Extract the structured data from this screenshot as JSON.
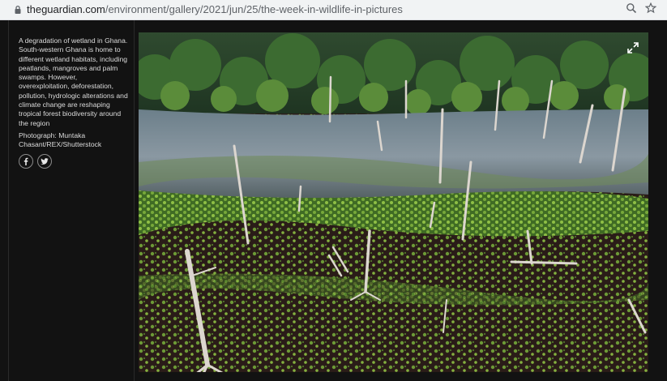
{
  "browser": {
    "url_host": "theguardian.com",
    "url_path": "/environment/gallery/2021/jun/25/the-week-in-wildlife-in-pictures"
  },
  "gallery": {
    "caption": "A degradation of wetland in Ghana. South-western Ghana is home to different wetland habitats, including peatlands, mangroves and palm swamps. However, overexploitation, deforestation, pollution, hydrologic alterations and climate change are reshaping tropical forest biodiversity around the region",
    "credit": "Photograph: Muntaka Chasant/REX/Shutterstock"
  },
  "share_icons": [
    "facebook-icon",
    "twitter-icon"
  ],
  "browser_icons": [
    "lock-icon",
    "zoom-icon",
    "star-icon"
  ],
  "photo_icons": [
    "expand-icon"
  ]
}
